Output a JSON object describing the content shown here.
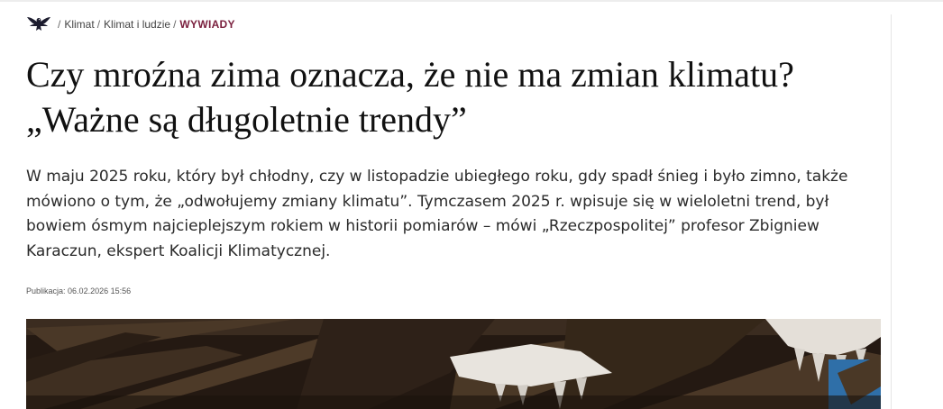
{
  "breadcrumb": {
    "logo_icon": "eagle-logo-icon",
    "items": [
      {
        "label": "Klimat",
        "separator": "/"
      },
      {
        "label": "Klimat i ludzie",
        "separator": "/"
      }
    ],
    "current": "WYWIADY",
    "current_color": "#7a1f3d"
  },
  "article": {
    "title_line1": "Czy mroźna zima oznacza, że nie ma zmian klimatu?",
    "title_line2": "„Ważne są długoletnie trendy”",
    "lead": "W maju 2025 roku, który był chłodny, czy w listopadzie ubiegłego roku, gdy spadł śnieg i było zimno, także mówiono o tym, że „odwołujemy zmiany klimatu”. Tymczasem 2025 r. wpisuje się w wieloletni trend, był bowiem ósmym najcieplejszym rokiem w historii pomiarów – mówi „Rzeczpospolitej” profesor Zbigniew Karaczun, ekspert Koalicji Klimatycznej.",
    "published_label": "Publikacja:",
    "published_date": "06.02.2026 15:56"
  },
  "hero_image": {
    "subject": "icicles-under-wooden-roof"
  }
}
